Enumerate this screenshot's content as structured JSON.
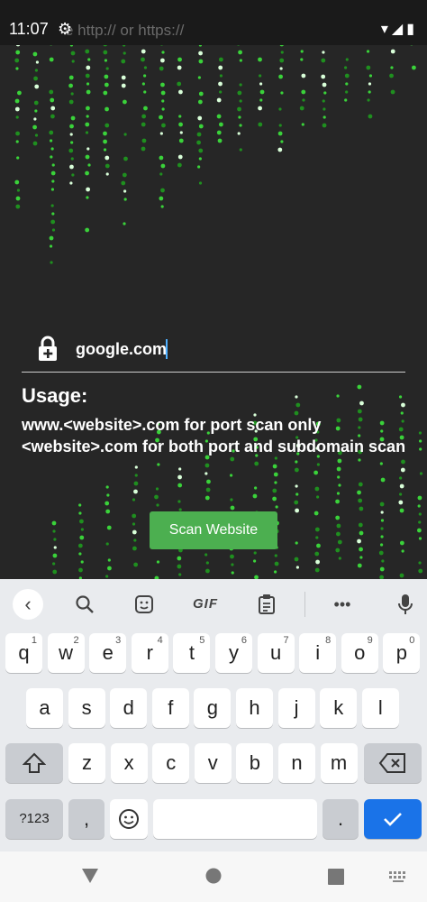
{
  "status_bar": {
    "time": "11:07",
    "settings_icon": "gear-icon",
    "url_hint": "e http:// or https://",
    "icons": [
      "wifi-icon",
      "signal-icon",
      "battery-icon"
    ]
  },
  "url_bar": {
    "lock_icon": "lock-add-icon",
    "value": "google.com"
  },
  "usage": {
    "title": "Usage:",
    "line1": "www.<website>.com for port scan only",
    "line2": "<website>.com for both port and subdomain scan"
  },
  "scan_button": {
    "label": "Scan Website",
    "color": "#4caf50"
  },
  "keyboard": {
    "toolbar": {
      "back_icon": "chevron-left-icon",
      "search_icon": "search-icon",
      "sticker_icon": "sticker-icon",
      "gif_label": "GIF",
      "clipboard_icon": "clipboard-icon",
      "more_icon": "more-dots-icon",
      "mic_icon": "mic-icon"
    },
    "row1": [
      {
        "k": "q",
        "h": "1"
      },
      {
        "k": "w",
        "h": "2"
      },
      {
        "k": "e",
        "h": "3"
      },
      {
        "k": "r",
        "h": "4"
      },
      {
        "k": "t",
        "h": "5"
      },
      {
        "k": "y",
        "h": "6"
      },
      {
        "k": "u",
        "h": "7"
      },
      {
        "k": "i",
        "h": "8"
      },
      {
        "k": "o",
        "h": "9"
      },
      {
        "k": "p",
        "h": "0"
      }
    ],
    "row2": [
      "a",
      "s",
      "d",
      "f",
      "g",
      "h",
      "j",
      "k",
      "l"
    ],
    "row3": [
      "z",
      "x",
      "c",
      "v",
      "b",
      "n",
      "m"
    ],
    "symbols_label": "?123",
    "comma": ",",
    "period": ".",
    "shift_icon": "shift-icon",
    "backspace_icon": "backspace-icon",
    "emoji_icon": "emoji-icon",
    "enter_icon": "check-icon"
  },
  "nav_bar": {
    "back_icon": "triangle-back-icon",
    "home_icon": "circle-home-icon",
    "recents_icon": "square-recents-icon",
    "keyboard_icon": "keyboard-switch-icon"
  }
}
